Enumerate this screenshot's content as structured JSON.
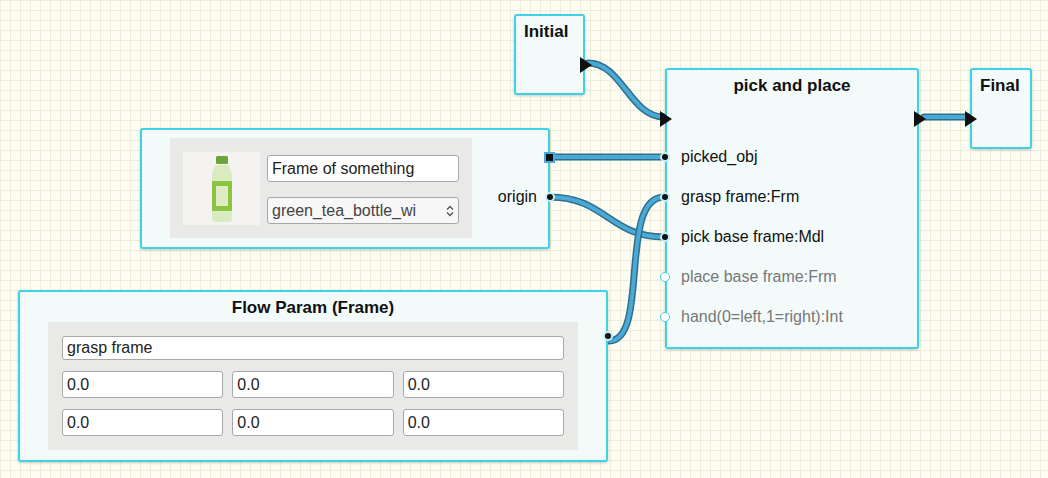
{
  "initial_node": {
    "title": "Initial"
  },
  "pick_and_place_node": {
    "title": "pick and place",
    "ports": [
      {
        "label": "picked_obj",
        "connected": true
      },
      {
        "label": "grasp frame:Frm",
        "connected": true
      },
      {
        "label": "pick base frame:Mdl",
        "connected": true
      },
      {
        "label": "place base frame:Frm",
        "connected": false
      },
      {
        "label": "hand(0=left,1=right):Int",
        "connected": false
      }
    ]
  },
  "final_node": {
    "title": "Final"
  },
  "object_node": {
    "name": "Frame of something",
    "model": "green_tea_bottle_wi",
    "output": "origin"
  },
  "flow_param_node": {
    "title": "Flow Param (Frame)",
    "name": "grasp frame",
    "values": [
      [
        "0.0",
        "0.0",
        "0.0"
      ],
      [
        "0.0",
        "0.0",
        "0.0"
      ]
    ]
  }
}
